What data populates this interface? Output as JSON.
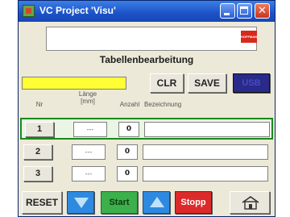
{
  "window": {
    "title": "VC Project 'Visu'",
    "close_glyph": "✕"
  },
  "logo": {
    "text": "HOFFMANN"
  },
  "heading": "Tabellenbearbeitung",
  "toolbar": {
    "clr_label": "CLR",
    "save_label": "SAVE",
    "usb_label": "USB"
  },
  "columns": {
    "nr": "Nr",
    "laenge": "Länge\n[mm]",
    "anzahl": "Anzahl",
    "bezeichnung": "Bezeichnung"
  },
  "rows": [
    {
      "nr": "1",
      "laenge": "---",
      "anzahl": "0",
      "bezeichnung": "",
      "selected": true
    },
    {
      "nr": "2",
      "laenge": "---",
      "anzahl": "0",
      "bezeichnung": "",
      "selected": false
    },
    {
      "nr": "3",
      "laenge": "---",
      "anzahl": "0",
      "bezeichnung": "",
      "selected": false
    }
  ],
  "bottom": {
    "reset_label": "RESET",
    "start_label": "Start",
    "stopp_label": "Stopp",
    "down_icon": "arrow-down-icon",
    "up_icon": "arrow-up-icon",
    "home_icon": "home-icon"
  },
  "colors": {
    "title_bar": "#1c52c8",
    "selected_row": "#1b8a1b",
    "yellow_field": "#ffff33",
    "start": "#3cb04a",
    "stopp": "#dc2a2a",
    "arrow": "#2e8adf",
    "usb": "#2a2a8a",
    "logo": "#d82a1c"
  }
}
